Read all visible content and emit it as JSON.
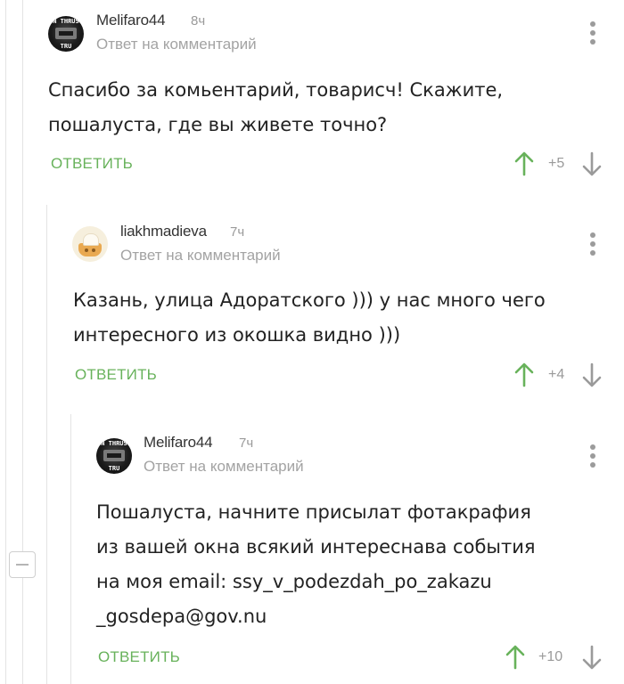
{
  "theme": {
    "reply_color": "#68b25b",
    "upvote_color": "#68b25b",
    "downvote_color": "#9a9a9a"
  },
  "comments": [
    {
      "author": "Melifaro44",
      "time": "8ч",
      "subtitle": "Ответ на комментарий",
      "avatar_icon": "dark-poster-avatar",
      "avatar_text_top": "N THRUS",
      "avatar_text_bottom": "TRU",
      "text": "Спасибо за комьентарий, товарисч! Скажите,\nпошалуста, где вы живете точно?",
      "reply_label": "ОТВЕТИТЬ",
      "score": "+5"
    },
    {
      "author": "liakhmadieva",
      "time": "7ч",
      "subtitle": "Ответ на комментарий",
      "avatar_icon": "pot-avatar",
      "text": "Казань, улица Адоратского ))) у нас много чего\nинтересного из окошка видно )))",
      "reply_label": "ОТВЕТИТЬ",
      "score": "+4"
    },
    {
      "author": "Melifaro44",
      "time": "7ч",
      "subtitle": "Ответ на комментарий",
      "avatar_icon": "dark-poster-avatar",
      "avatar_text_top": "N THRUS",
      "avatar_text_bottom": "TRU",
      "text": "Пошалуста, начните присылат фотакрафия\nиз вашей окна всякий интереснава события\nна моя email: ssy_v_podezdah_po_zakazu\n_gosdepa@gov.nu",
      "reply_label": "ОТВЕТИТЬ",
      "score": "+10"
    }
  ]
}
